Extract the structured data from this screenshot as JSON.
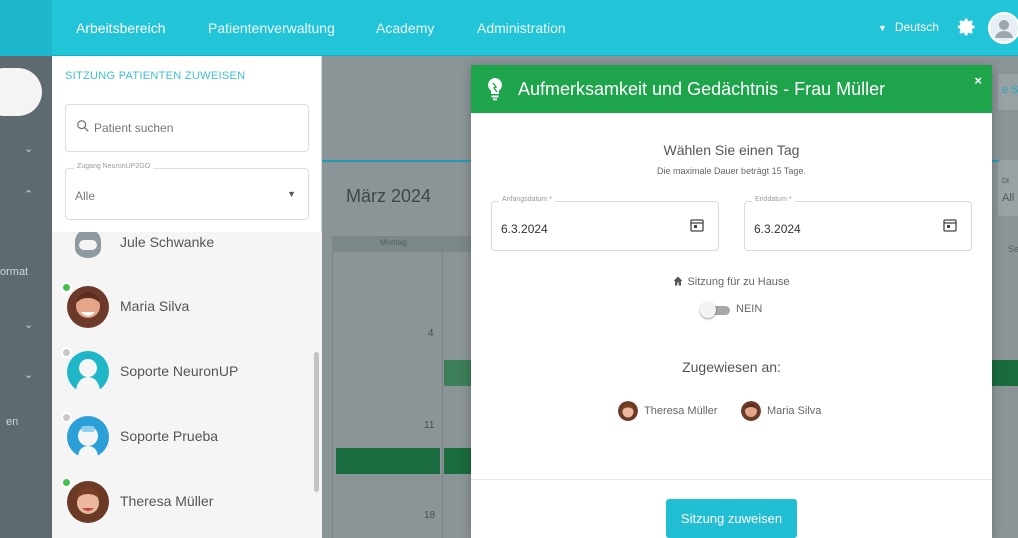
{
  "nav": {
    "items": [
      {
        "label": "Arbeitsbereich",
        "active": true
      },
      {
        "label": "Patientenverwaltung",
        "active": false
      },
      {
        "label": "Academy",
        "active": false
      },
      {
        "label": "Administration",
        "active": false
      }
    ],
    "language": "Deutsch",
    "icons": [
      "gear-icon",
      "user-avatar-icon"
    ]
  },
  "sidebar": {
    "partial_label_1": "ormat",
    "partial_label_2": "en"
  },
  "assign_panel": {
    "title": "SITZUNG PATIENTEN ZUWEISEN",
    "search_placeholder": "Patient suchen",
    "access_label": "Zugang NeuronUP2GO",
    "access_value": "Alle",
    "patients": [
      {
        "name": "Jule Schwanke",
        "status": "none",
        "avatar_color": "#8f9aa0"
      },
      {
        "name": "Maria Silva",
        "status": "online",
        "avatar_color": "#c0734f"
      },
      {
        "name": "Soporte NeuronUP",
        "status": "offline",
        "avatar_color": "#1fb6c8"
      },
      {
        "name": "Soporte Prueba",
        "status": "offline",
        "avatar_color": "#2a9fd8"
      },
      {
        "name": "Theresa Müller",
        "status": "online",
        "avatar_color": "#8a4e36"
      }
    ]
  },
  "calendar": {
    "month": "März 2024",
    "day_header": "Montag",
    "day_numbers": [
      "4",
      "11",
      "18"
    ],
    "partial_right_tab": "e Sit",
    "partial_right_field_label": "Dt",
    "partial_right_field_value": "All",
    "partial_right_col": "Se"
  },
  "modal": {
    "title": "Aufmerksamkeit und Gedächtnis - Frau Müller",
    "close": "×",
    "heading": "Wählen Sie einen Tag",
    "subheading": "Die maximale Dauer beträgt 15 Tage.",
    "start_label": "Anfangsdatum *",
    "start_value": "6.3.2024",
    "end_label": "Enddatum *",
    "end_value": "6.3.2024",
    "home_label": "Sitzung für zu Hause",
    "toggle_value": "NEIN",
    "toggle_on": false,
    "assigned_title": "Zugewiesen an:",
    "assignees": [
      {
        "name": "Theresa Müller",
        "avatar_color": "#8a4e36"
      },
      {
        "name": "Maria Silva",
        "avatar_color": "#c0734f"
      }
    ],
    "assign_button": "Sitzung zuweisen",
    "colors": {
      "header": "#1ea54c",
      "button": "#22bfd4"
    }
  }
}
